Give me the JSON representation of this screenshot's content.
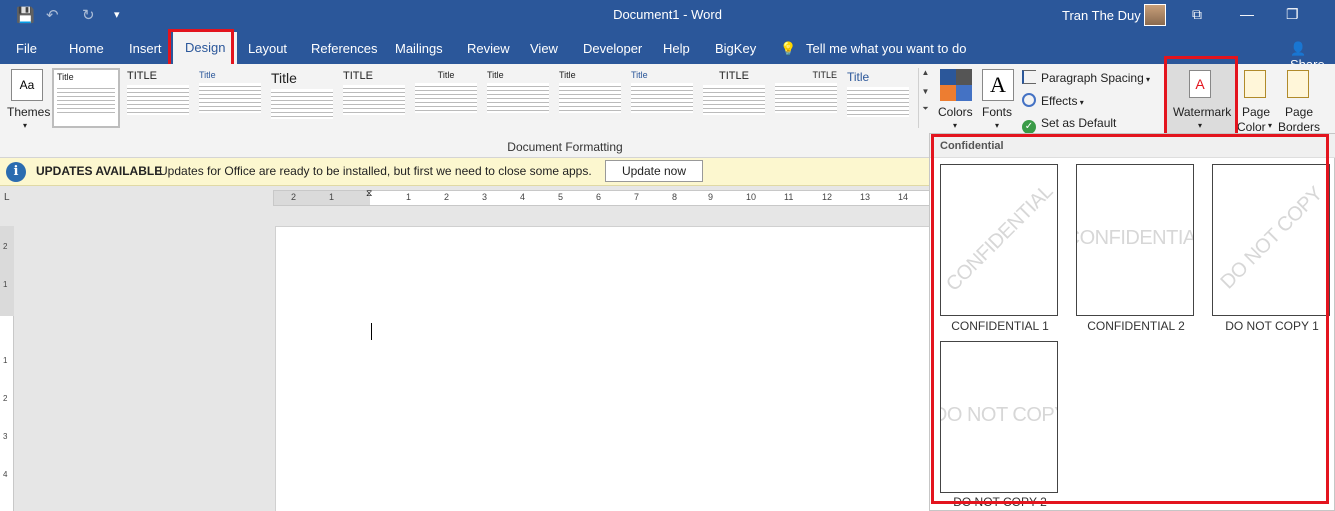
{
  "window": {
    "title": "Document1 - Word",
    "user": "Tran The Duy",
    "share_label": "Share"
  },
  "tabs": [
    {
      "label": "File"
    },
    {
      "label": "Home"
    },
    {
      "label": "Insert"
    },
    {
      "label": "Design",
      "active": true
    },
    {
      "label": "Layout"
    },
    {
      "label": "References"
    },
    {
      "label": "Mailings"
    },
    {
      "label": "Review"
    },
    {
      "label": "View"
    },
    {
      "label": "Developer"
    },
    {
      "label": "Help"
    },
    {
      "label": "BigKey"
    }
  ],
  "tell_me": "Tell me what you want to do",
  "ribbon": {
    "themes_label": "Themes",
    "style_set_titles": [
      "Title",
      "TITLE",
      "Title",
      "Title",
      "TITLE",
      "Title",
      "Title",
      "Title",
      "Title",
      "TITLE",
      "TITLE",
      "Title"
    ],
    "group_label": "Document Formatting",
    "colors_label": "Colors",
    "fonts_label": "Fonts",
    "fonts_glyph": "A",
    "paragraph_spacing": "Paragraph Spacing",
    "effects": "Effects",
    "set_default": "Set as Default",
    "watermark": "Watermark",
    "page_color_1": "Page",
    "page_color_2": "Color",
    "page_borders_1": "Page",
    "page_borders_2": "Borders"
  },
  "update_bar": {
    "title": "UPDATES AVAILABLE",
    "message": "Updates for Office are ready to be installed, but first we need to close some apps.",
    "button": "Update now"
  },
  "ruler": {
    "h_numbers": [
      "2",
      "1",
      "1",
      "2",
      "3",
      "4",
      "5",
      "6",
      "7",
      "8",
      "9",
      "10",
      "11",
      "12",
      "13",
      "14"
    ],
    "v_numbers": [
      "2",
      "1",
      "1",
      "2",
      "3",
      "4"
    ]
  },
  "watermark_panel": {
    "section": "Confidential",
    "items": [
      {
        "label": "CONFIDENTIAL 1",
        "text": "CONFIDENTIAL",
        "rotated": true
      },
      {
        "label": "CONFIDENTIAL 2",
        "text": "CONFIDENTIAL",
        "rotated": false
      },
      {
        "label": "DO NOT COPY 1",
        "text": "DO NOT COPY",
        "rotated": true
      },
      {
        "label": "DO NOT COPY 2",
        "text": "DO NOT COPY",
        "rotated": false
      }
    ]
  },
  "colors": {
    "title_bar": "#2b579a",
    "highlight": "#e3141e",
    "update_bar": "#fcf7cf"
  }
}
